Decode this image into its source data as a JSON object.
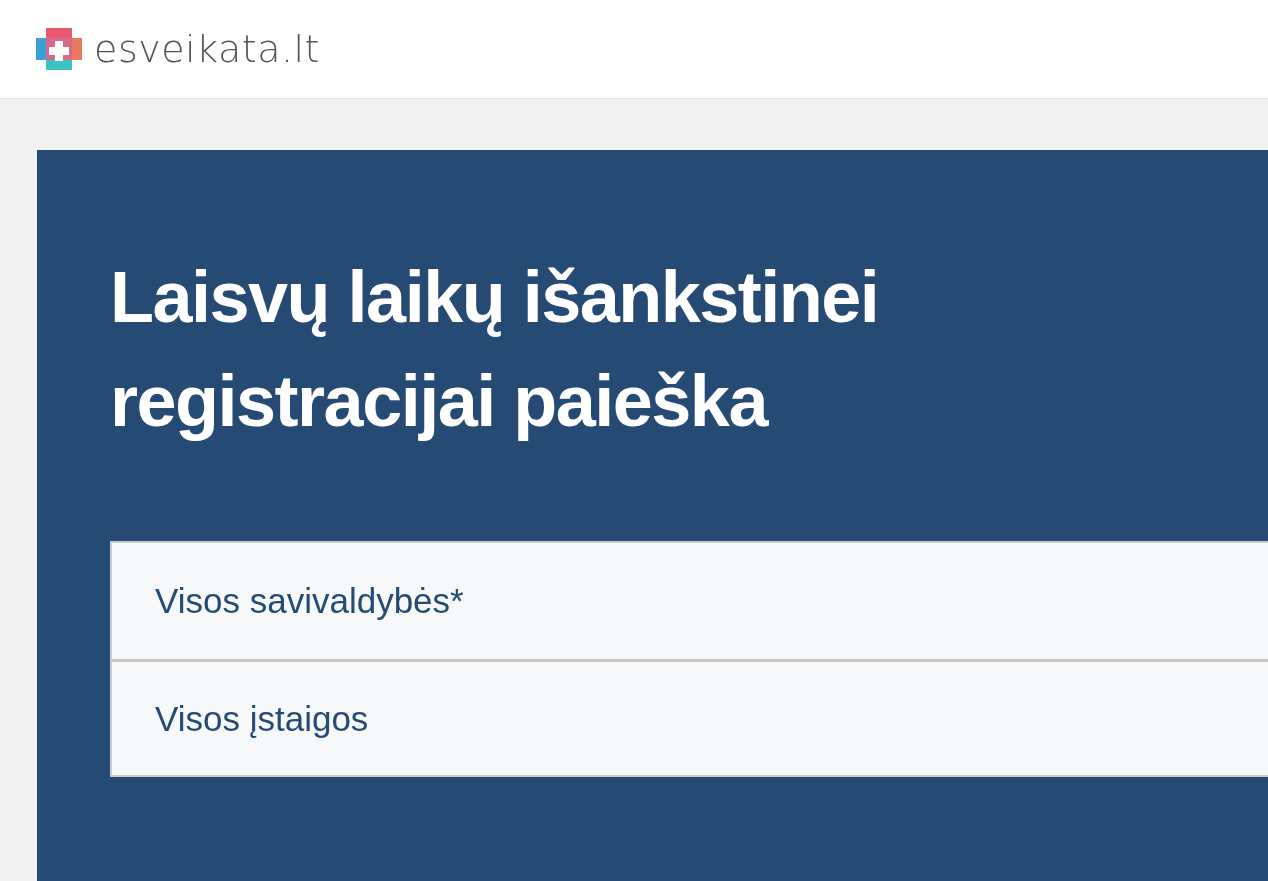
{
  "header": {
    "logo_text": "esveikata.lt"
  },
  "search_panel": {
    "title": "Laisvų laikų išankstinei registracijai paieška",
    "fields": [
      {
        "value": "Visos savivaldybės*"
      },
      {
        "value": "Visos įstaigos"
      }
    ]
  }
}
